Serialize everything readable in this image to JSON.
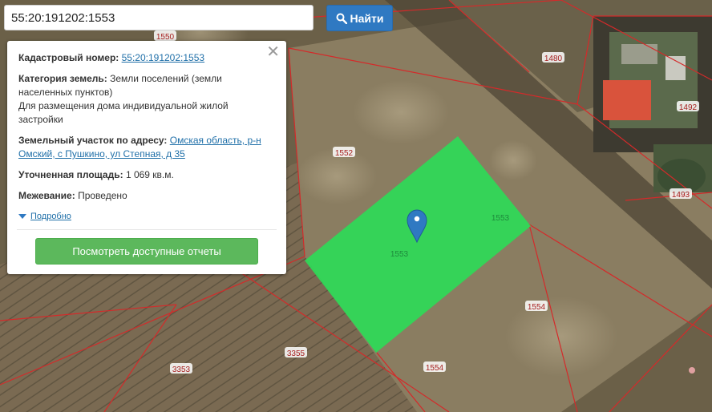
{
  "search": {
    "value": "55:20:191202:1553",
    "button_label": "Найти"
  },
  "map": {
    "selected_parcel_color": "#2ed957",
    "boundary_color": "#d42a2a",
    "labels": {
      "l1550": "1550",
      "l1480": "1480",
      "l1492": "1492",
      "l1493": "1493",
      "l1552": "1552",
      "l1553a": "1553",
      "l1553b": "1553",
      "l1554a": "1554",
      "l1554b": "1554",
      "l3355": "3355",
      "l3353": "3353"
    }
  },
  "panel": {
    "cadastral_label": "Кадастровый номер:",
    "cadastral_value": "55:20:191202:1553",
    "category_label": "Категория земель:",
    "category_value": "Земли поселений (земли населенных пунктов)",
    "category_use": "Для размещения дома индивидуальной жилой застройки",
    "address_label": "Земельный участок по адресу:",
    "address_value": "Омская область, р-н Омский, с Пушкино, ул Степная, д 35",
    "area_label": "Уточненная площадь:",
    "area_value": "1 069 кв.м.",
    "survey_label": "Межевание:",
    "survey_value": "Проведено",
    "more_label": "Подробно",
    "report_button": "Посмотреть доступные отчеты"
  }
}
